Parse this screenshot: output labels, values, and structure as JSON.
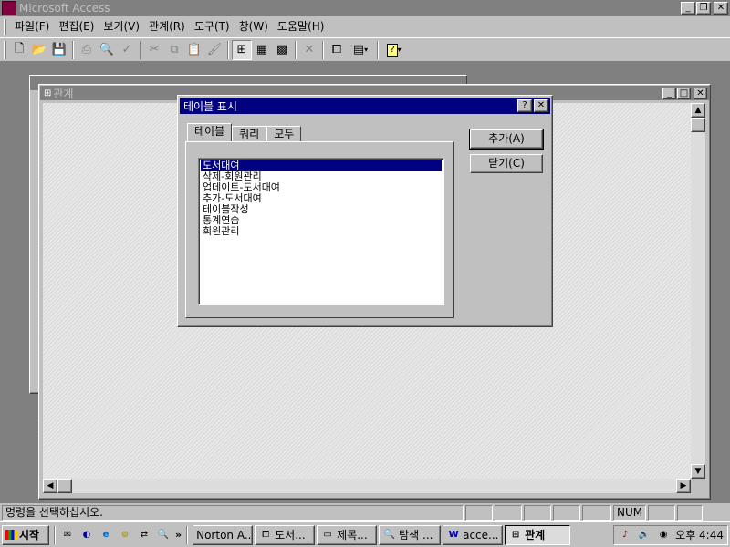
{
  "app": {
    "title": "Microsoft Access"
  },
  "menu": {
    "items": [
      "파일(F)",
      "편집(E)",
      "보기(V)",
      "관계(R)",
      "도구(T)",
      "창(W)",
      "도움말(H)"
    ]
  },
  "toolbar": {
    "icons": [
      "new-icon",
      "open-icon",
      "save-icon",
      "print-icon",
      "print-preview-icon",
      "spelling-icon",
      "cut-icon",
      "copy-icon",
      "paste-icon",
      "format-painter-icon",
      "show-table-icon",
      "show-direct-icon",
      "show-all-icon",
      "delete-icon",
      "database-window-icon",
      "new-object-icon",
      "help-icon"
    ]
  },
  "relationship_window": {
    "title": "관계"
  },
  "dialog": {
    "title": "테이블 표시",
    "help_glyph": "?",
    "close_glyph": "✕",
    "tabs": [
      "테이블",
      "쿼리",
      "모두"
    ],
    "active_tab": "테이블",
    "tables": [
      "도서대여",
      "삭제-회원관리",
      "업데이트-도서대여",
      "추가-도서대여",
      "테이블작성",
      "통계연습",
      "회원관리"
    ],
    "selected_index": 0,
    "add_button": "추가(A)",
    "close_button": "닫기(C)"
  },
  "statusbar": {
    "message": "명령을 선택하십시오.",
    "num": "NUM"
  },
  "taskbar": {
    "start_label": "시작",
    "tasks": [
      {
        "label": "Norton A...",
        "icon": "norton-icon"
      },
      {
        "label": "도서...",
        "icon": "database-icon"
      },
      {
        "label": "제목...",
        "icon": "window-icon"
      },
      {
        "label": "탐색 ...",
        "icon": "explorer-icon"
      },
      {
        "label": "acce...",
        "icon": "word-icon"
      },
      {
        "label": "관계",
        "icon": "relationships-icon"
      }
    ],
    "active_task_index": 5,
    "clock": "오후 4:44"
  },
  "colors": {
    "face": "#c0c0c0",
    "inactive_title": "#808080",
    "active_title": "#000080",
    "selection": "#000080"
  }
}
